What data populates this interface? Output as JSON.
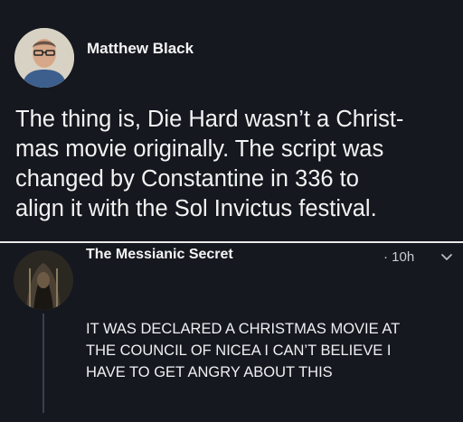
{
  "post": {
    "author": "Matthew Black",
    "lines": [
      "The thing is, Die Hard wasn’t a Christ-",
      "mas movie originally. The script was",
      "changed by Constantine in 336 to",
      "align it with the Sol Invictus festival."
    ]
  },
  "reply": {
    "author": "The Messianic Secret",
    "time": "· 10h",
    "lines": [
      "IT WAS DECLARED A CHRISTMAS MOVIE AT",
      "THE COUNCIL OF NICEA I CAN’T BELIEVE I",
      "HAVE TO GET ANGRY ABOUT THIS"
    ]
  },
  "icons": {
    "more": "chevron-down-icon"
  }
}
